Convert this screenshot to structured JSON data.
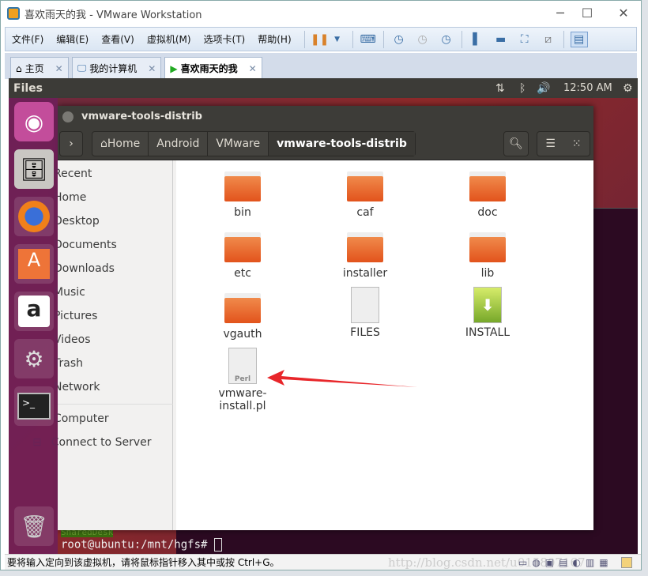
{
  "window": {
    "title": "喜欢雨天的我 - VMware Workstation"
  },
  "menu": [
    "文件(F)",
    "编辑(E)",
    "查看(V)",
    "虚拟机(M)",
    "选项卡(T)",
    "帮助(H)"
  ],
  "tabs": [
    {
      "label": "主页"
    },
    {
      "label": "我的计算机"
    },
    {
      "label": "喜欢雨天的我"
    }
  ],
  "panel": {
    "app": "Files",
    "time": "12:50 AM"
  },
  "files_window": {
    "title": "vmware-tools-distrib",
    "breadcrumb": [
      "Home",
      "Android",
      "VMware",
      "vmware-tools-distrib"
    ],
    "sidebar": [
      "Recent",
      "Home",
      "Desktop",
      "Documents",
      "Downloads",
      "Music",
      "Pictures",
      "Videos",
      "Trash",
      "Network",
      "Computer",
      "Connect to Server"
    ],
    "items": [
      {
        "name": "bin",
        "type": "folder"
      },
      {
        "name": "caf",
        "type": "folder"
      },
      {
        "name": "doc",
        "type": "folder"
      },
      {
        "name": "etc",
        "type": "folder"
      },
      {
        "name": "installer",
        "type": "folder"
      },
      {
        "name": "lib",
        "type": "folder"
      },
      {
        "name": "vgauth",
        "type": "folder"
      },
      {
        "name": "FILES",
        "type": "text"
      },
      {
        "name": "INSTALL",
        "type": "install"
      },
      {
        "name": "vmware-install.pl",
        "type": "perl",
        "badge": "Perl"
      }
    ]
  },
  "terminal": {
    "highlight": "SharedDesk",
    "prompt": "root@ubuntu:/mnt/hgfs#"
  },
  "status": {
    "hint": "要将输入定向到该虚拟机，请将鼠标指针移入其中或按 Ctrl+G。",
    "watermark": "http://blog.csdn.net/u015807167"
  },
  "colors": {
    "arrow": "#e8262a",
    "folder": "#e2531c"
  }
}
